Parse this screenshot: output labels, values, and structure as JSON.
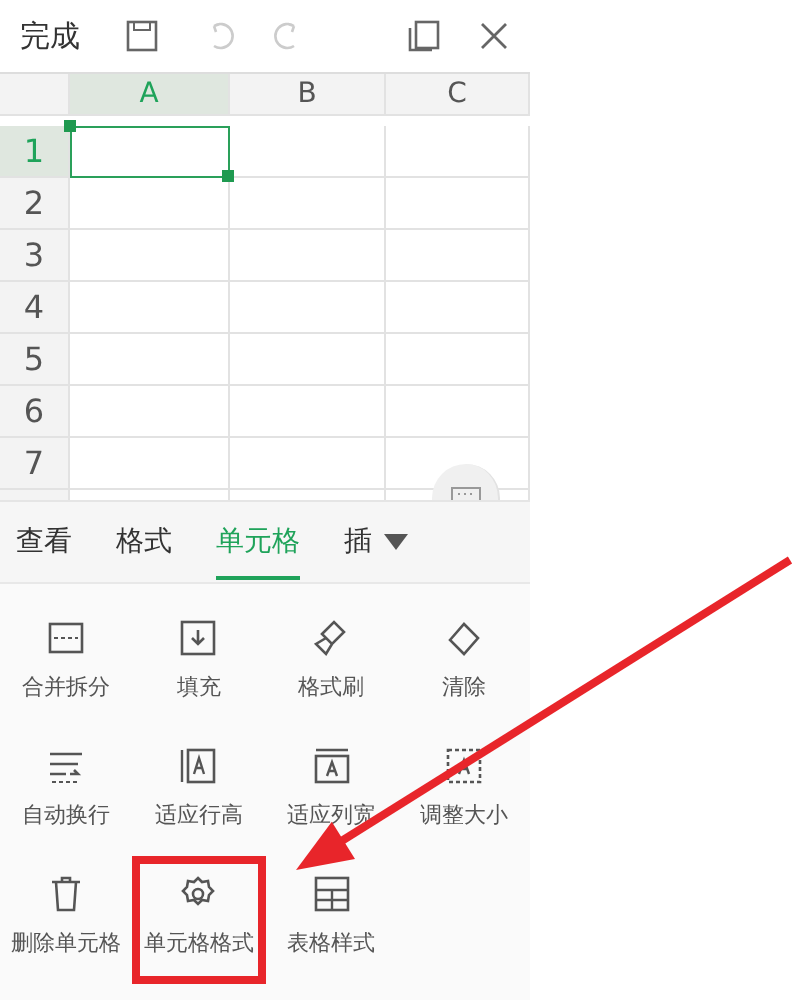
{
  "toolbar": {
    "done": "完成"
  },
  "sheet": {
    "columns": [
      {
        "label": "A",
        "selected": true
      },
      {
        "label": "B",
        "selected": false
      },
      {
        "label": "C",
        "selected": false
      }
    ],
    "rows": [
      {
        "label": "1",
        "selected": true
      },
      {
        "label": "2",
        "selected": false
      },
      {
        "label": "3",
        "selected": false
      },
      {
        "label": "4",
        "selected": false
      },
      {
        "label": "5",
        "selected": false
      },
      {
        "label": "6",
        "selected": false
      },
      {
        "label": "7",
        "selected": false
      }
    ]
  },
  "tabs": [
    {
      "label": "查看",
      "selected": false
    },
    {
      "label": "格式",
      "selected": false
    },
    {
      "label": "单元格",
      "selected": true
    },
    {
      "label": "插",
      "selected": false
    }
  ],
  "tools": [
    {
      "label": "合并拆分",
      "highlighted": false
    },
    {
      "label": "填充",
      "highlighted": false
    },
    {
      "label": "格式刷",
      "highlighted": false
    },
    {
      "label": "清除",
      "highlighted": false
    },
    {
      "label": "自动换行",
      "highlighted": false
    },
    {
      "label": "适应行高",
      "highlighted": false
    },
    {
      "label": "适应列宽",
      "highlighted": false
    },
    {
      "label": "调整大小",
      "highlighted": false
    },
    {
      "label": "删除单元格",
      "highlighted": false
    },
    {
      "label": "单元格格式",
      "highlighted": true
    },
    {
      "label": "表格样式",
      "highlighted": false
    }
  ]
}
